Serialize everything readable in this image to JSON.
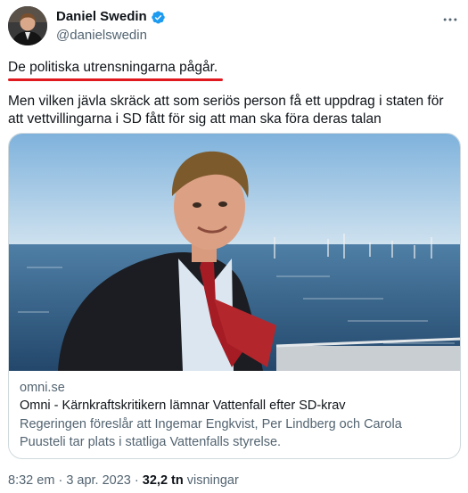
{
  "author": {
    "display_name": "Daniel Swedin",
    "handle": "@danielswedin"
  },
  "tweet": {
    "lines": [
      "De politiska utrensningarna pågår.",
      "Men vilken jävla skräck att som seriös person få ett uppdrag i staten för att vettvillingarna i SD fått för sig att man ska föra deras talan"
    ]
  },
  "card": {
    "domain": "omni.se",
    "title": "Omni - Kärnkraftskritikern lämnar Vattenfall efter SD-krav",
    "description": "Regeringen föreslår att Ingemar Engkvist, Per Lindberg och Carola Puusteli tar plats i statliga Vattenfalls styrelse."
  },
  "footer": {
    "time": "8:32 em",
    "separator": "·",
    "date": "3 apr. 2023",
    "views_count": "32,2 tn",
    "views_label": "visningar"
  },
  "colors": {
    "accent": "#1d9bf0",
    "underline": "#e0191f",
    "secondary_text": "#536471",
    "border": "#cfd9de"
  },
  "icons": [
    "verified-badge-icon",
    "more-icon"
  ]
}
